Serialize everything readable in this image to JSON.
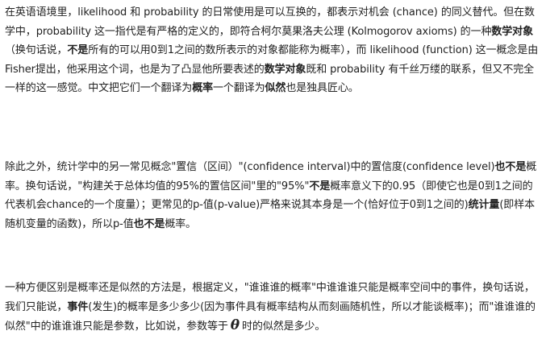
{
  "paragraphs": [
    {
      "segments": [
        {
          "t": "在英语语境里，likelihood 和 probability 的日常使用是可以互换的，都表示对机会 (chance) 的同义替代。但在数学中，probability 这一指代是有严格的定义的，即符合柯尔莫果洛夫公理 (Kolmogorov axioms) 的一种"
        },
        {
          "t": "数学对象",
          "b": true
        },
        {
          "t": "（换句话说，"
        },
        {
          "t": "不是",
          "b": true
        },
        {
          "t": "所有的可以用0到1之间的数所表示的对象都能称为概率），而 likelihood (function) 这一概念是由Fisher提出，他采用这个词，也是为了凸显他所要表述的"
        },
        {
          "t": "数学对象",
          "b": true
        },
        {
          "t": "既和 probability 有千丝万缕的联系，但又不完全一样的这一感觉。中文把它们一个翻译为"
        },
        {
          "t": "概率",
          "b": true
        },
        {
          "t": "一个翻译为"
        },
        {
          "t": "似然",
          "b": true
        },
        {
          "t": "也是独具匠心。"
        }
      ]
    },
    {
      "segments": [
        {
          "t": "除此之外，统计学中的另一常见概念\"置信（区间）\"(confidence interval)中的置信度(confidence level)"
        },
        {
          "t": "也不是",
          "b": true
        },
        {
          "t": "概率。换句话说，\"构建关于总体均值的95%的置信区间\"里的\"95%\""
        },
        {
          "t": "不是",
          "b": true
        },
        {
          "t": "概率意义下的0.95（即使它也是0到1之间的代表机会chance的一个度量）；更常见的p-值(p-value)严格来说其本身是一个(恰好位于0到1之间的)"
        },
        {
          "t": "统计量",
          "b": true
        },
        {
          "t": "(即样本随机变量的函数)，所以p-值"
        },
        {
          "t": "也不是",
          "b": true
        },
        {
          "t": "概率。"
        }
      ]
    },
    {
      "segments": [
        {
          "t": "一种方便区别是概率还是似然的方法是，根据定义，\"谁谁谁的概率\"中谁谁谁只能是概率空间中的事件，换句话说，我们只能说，"
        },
        {
          "t": "事件",
          "b": true
        },
        {
          "t": "(发生)的概率是多少多少(因为事件具有概率结构从而刻画随机性，所以才能谈概率)；而\"谁谁谁的似然\"中的谁谁谁只能是参数，比如说，参数等于"
        },
        {
          "t": "θ",
          "theta": true
        },
        {
          "t": "时的似然是多少。"
        }
      ]
    }
  ]
}
